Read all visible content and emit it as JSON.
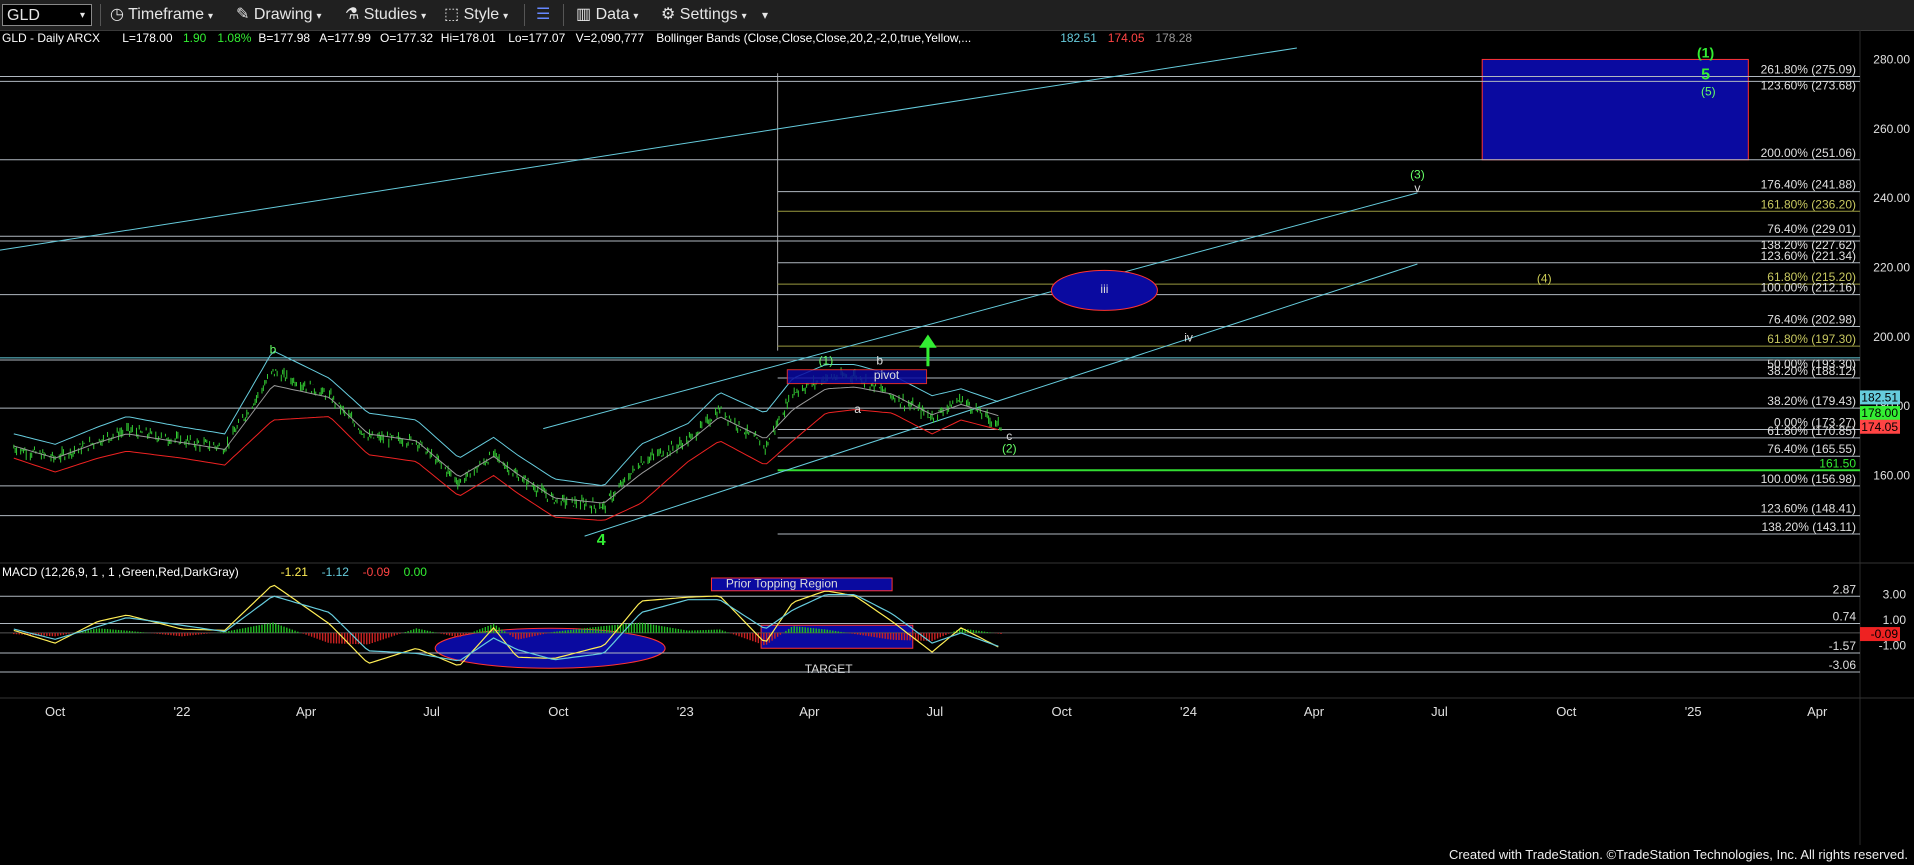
{
  "toolbar": {
    "symbol": "GLD",
    "timeframe": "Timeframe",
    "drawing": "Drawing",
    "studies": "Studies",
    "style": "Style",
    "data": "Data",
    "settings": "Settings"
  },
  "header": {
    "parts": [
      {
        "text": "GLD - Daily  ARCX",
        "color": "#ffffff"
      },
      {
        "text": "L=178.00",
        "color": "#ffffff"
      },
      {
        "text": "1.90",
        "color": "#33ee33"
      },
      {
        "text": "1.08%",
        "color": "#33ee33"
      },
      {
        "text": "B=177.98",
        "color": "#ffffff"
      },
      {
        "text": "A=177.99",
        "color": "#ffffff"
      },
      {
        "text": "O=177.32",
        "color": "#ffffff"
      },
      {
        "text": "Hi=178.01",
        "color": "#ffffff"
      },
      {
        "text": "Lo=177.07",
        "color": "#ffffff"
      },
      {
        "text": "V=2,090,777",
        "color": "#ffffff"
      },
      {
        "text": "Bollinger Bands (Close,Close,Close,20,2,-2,0,true,Yellow,...",
        "color": "#ffffff"
      },
      {
        "text": "182.51",
        "color": "#66ccdd"
      },
      {
        "text": "174.05",
        "color": "#ff4444"
      },
      {
        "text": "178.28",
        "color": "#999999"
      }
    ]
  },
  "macd_header": {
    "parts": [
      {
        "text": "MACD (12,26,9, 1 , 1 ,Green,Red,DarkGray)",
        "color": "#ffffff"
      },
      {
        "text": "-1.21",
        "color": "#ffee55"
      },
      {
        "text": "-1.12",
        "color": "#66ccdd"
      },
      {
        "text": "-0.09",
        "color": "#ff4444"
      },
      {
        "text": "0.00",
        "color": "#33ee33"
      }
    ]
  },
  "colors": {
    "background": "#000000",
    "price_bars": "#33cc33",
    "bb_upper": "#66ccdd",
    "bb_lower": "#ee2222",
    "bb_mid": "#999999",
    "channel": "#66ccdd",
    "fib_line": "#b0b8c0",
    "fib_olive": "#9a9a40",
    "target_box": "#0a0aa0",
    "target_border": "#ff3333",
    "wave_label": "#33ee33",
    "label_green": "#66ff66"
  },
  "chart_data": [
    {
      "type": "line",
      "name": "price",
      "x": [
        "2021-09-01",
        "2021-10-01",
        "2021-11-01",
        "2021-11-22",
        "2022-01-01",
        "2022-02-01",
        "2022-03-08",
        "2022-04-18",
        "2022-05-16",
        "2022-06-20",
        "2022-07-21",
        "2022-08-15",
        "2022-09-01",
        "2022-09-28",
        "2022-11-03",
        "2022-11-30",
        "2023-01-03",
        "2023-01-26",
        "2023-02-28",
        "2023-03-20",
        "2023-04-13",
        "2023-05-04",
        "2023-05-31",
        "2023-06-29",
        "2023-07-20",
        "2023-08-18"
      ],
      "close": [
        168,
        165,
        170,
        173,
        170,
        168,
        190,
        183,
        171,
        170,
        158,
        166,
        160,
        153,
        151,
        164,
        170,
        179,
        168,
        184,
        188,
        189,
        183,
        177,
        182,
        174
      ],
      "high": [
        170,
        167,
        172,
        174,
        172,
        171,
        193,
        185,
        173,
        172,
        160,
        168,
        162,
        154,
        153,
        166,
        172,
        181,
        170,
        186,
        190,
        191,
        185,
        179,
        184,
        176
      ],
      "low": [
        166,
        163,
        168,
        171,
        168,
        166,
        187,
        181,
        169,
        168,
        156,
        164,
        158,
        151,
        149,
        162,
        168,
        177,
        166,
        182,
        186,
        187,
        181,
        175,
        180,
        172
      ],
      "bb_upper": [
        172,
        169,
        174,
        177,
        174,
        172,
        196,
        188,
        178,
        176,
        165,
        171,
        166,
        159,
        157,
        169,
        175,
        184,
        178,
        188,
        192,
        192,
        189,
        183,
        185,
        181
      ],
      "bb_lower": [
        165,
        161,
        165,
        167,
        165,
        163,
        176,
        177,
        166,
        164,
        154,
        160,
        155,
        148,
        147,
        152,
        164,
        170,
        163,
        170,
        178,
        179,
        178,
        172,
        176,
        173
      ]
    },
    {
      "type": "table",
      "name": "fibonacci-levels",
      "levels": [
        {
          "label": "261.80% (275.09)",
          "value": 275.09
        },
        {
          "label": "123.60% (273.68)",
          "value": 273.68
        },
        {
          "label": "200.00% (251.06)",
          "value": 251.06
        },
        {
          "label": "176.40% (241.88)",
          "value": 241.88
        },
        {
          "label": "161.80% (236.20)",
          "value": 236.2
        },
        {
          "label": "76.40% (229.01)",
          "value": 229.01
        },
        {
          "label": "138.20% (227.62)",
          "value": 227.62
        },
        {
          "label": "123.60% (221.34)",
          "value": 221.34
        },
        {
          "label": "61.80% (215.20)",
          "value": 215.2
        },
        {
          "label": "100.00% (212.16)",
          "value": 212.16
        },
        {
          "label": "76.40% (202.98)",
          "value": 202.98
        },
        {
          "label": "61.80% (197.30)",
          "value": 197.3
        },
        {
          "label": "50.00% (193.30)",
          "value": 193.3
        },
        {
          "label": "38.20% (188.12)",
          "value": 188.12
        },
        {
          "label": "38.20% (179.43)",
          "value": 179.43
        },
        {
          "label": "0.00% (173.27)",
          "value": 173.27
        },
        {
          "label": "61.80% (170.85)",
          "value": 170.85
        },
        {
          "label": "76.40% (165.55)",
          "value": 165.55
        },
        {
          "label": "161.50",
          "value": 161.5
        },
        {
          "label": "100.00% (156.98)",
          "value": 156.98
        },
        {
          "label": "123.60% (148.41)",
          "value": 148.41
        },
        {
          "label": "138.20% (143.11)",
          "value": 143.11
        }
      ]
    },
    {
      "type": "line",
      "name": "macd",
      "x": [
        "2021-09-01",
        "2021-10-01",
        "2021-11-01",
        "2021-11-22",
        "2022-01-01",
        "2022-02-01",
        "2022-03-08",
        "2022-04-18",
        "2022-05-16",
        "2022-06-20",
        "2022-07-21",
        "2022-08-15",
        "2022-09-01",
        "2022-09-28",
        "2022-11-03",
        "2022-11-30",
        "2023-01-03",
        "2023-01-26",
        "2023-02-28",
        "2023-03-20",
        "2023-04-13",
        "2023-05-04",
        "2023-05-31",
        "2023-06-29",
        "2023-07-20",
        "2023-08-18"
      ],
      "macd": [
        0.2,
        -0.8,
        0.9,
        1.4,
        0.3,
        0.2,
        3.8,
        0.7,
        -2.4,
        -1.2,
        -2.6,
        0.4,
        -1.9,
        -2.0,
        -1.0,
        2.5,
        2.8,
        2.9,
        -0.8,
        2.4,
        3.3,
        2.9,
        0.9,
        -1.5,
        0.4,
        -1.21
      ],
      "signal": [
        0.3,
        -0.5,
        0.5,
        1.2,
        0.6,
        0.1,
        2.9,
        1.6,
        -1.4,
        -1.6,
        -2.2,
        -0.4,
        -1.3,
        -2.1,
        -1.6,
        1.6,
        2.6,
        2.6,
        0.3,
        1.8,
        3.0,
        3.0,
        1.5,
        -0.8,
        0.0,
        -1.12
      ],
      "ylim": [
        -3.06,
        4.3
      ],
      "levels": [
        {
          "label": "2.87",
          "value": 2.87
        },
        {
          "label": "0.74",
          "value": 0.74
        },
        {
          "label": "-1.57",
          "value": -1.57
        },
        {
          "label": "-3.06",
          "value": -3.06
        }
      ],
      "axis_ticks": [
        "3.00",
        "1.00",
        "-1.00"
      ],
      "last_value_label": "-0.09"
    }
  ],
  "axis": {
    "price_ticks": [
      "280.00",
      "260.00",
      "240.00",
      "220.00",
      "200.00",
      "180.00",
      "160.00"
    ],
    "price_tick_values": [
      280,
      260,
      240,
      220,
      200,
      180,
      160
    ],
    "price_ylim": [
      138.5,
      283.3
    ],
    "x_ticks": [
      {
        "label": "Oct",
        "date": "2021-10-01"
      },
      {
        "label": "'22",
        "date": "2022-01-01"
      },
      {
        "label": "Apr",
        "date": "2022-04-01"
      },
      {
        "label": "Jul",
        "date": "2022-07-01"
      },
      {
        "label": "Oct",
        "date": "2022-10-01"
      },
      {
        "label": "'23",
        "date": "2023-01-01"
      },
      {
        "label": "Apr",
        "date": "2023-04-01"
      },
      {
        "label": "Jul",
        "date": "2023-07-01"
      },
      {
        "label": "Oct",
        "date": "2023-10-01"
      },
      {
        "label": "'24",
        "date": "2024-01-01"
      },
      {
        "label": "Apr",
        "date": "2024-04-01"
      },
      {
        "label": "Jul",
        "date": "2024-07-01"
      },
      {
        "label": "Oct",
        "date": "2024-10-01"
      },
      {
        "label": "'25",
        "date": "2025-01-01"
      },
      {
        "label": "Apr",
        "date": "2025-04-01"
      }
    ],
    "last_price_tags": [
      {
        "label": "182.51",
        "value": 182.51,
        "color": "#66ccdd"
      },
      {
        "label": "178.00",
        "value": 178.0,
        "color": "#33ee33"
      },
      {
        "label": "174.05",
        "value": 174.05,
        "color": "#ff4444"
      }
    ]
  },
  "annotations": {
    "wave_b": "b",
    "wave_4": "4",
    "wave_1": "(1)",
    "wave_b2": "b",
    "wave_a": "a",
    "pivot": "pivot",
    "wave_c": "c",
    "wave_2": "(2)",
    "wave_iii": "iii",
    "wave_iv": "iv",
    "wave_3": "(3)",
    "wave_v": "v",
    "wave_4c": "(4)",
    "wave_top1": "(1)",
    "wave_5": "5",
    "wave_5p": "(5)",
    "prior_topping": "Prior Topping Region",
    "target": "TARGET"
  },
  "footer": "Created with TradeStation. ©TradeStation Technologies, Inc. All rights reserved."
}
